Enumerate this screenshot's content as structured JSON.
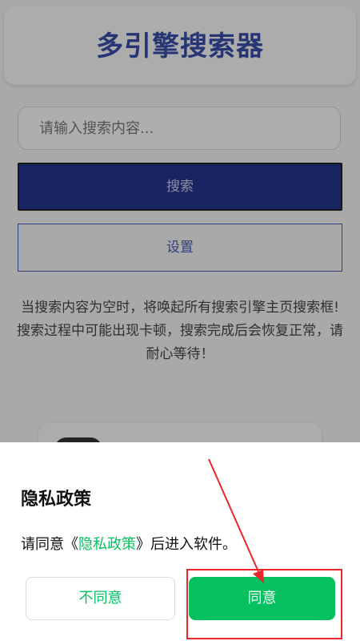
{
  "app": {
    "title": "多引擎搜索器",
    "search": {
      "placeholder": "请输入搜索内容..."
    },
    "search_label": "搜索",
    "settings_label": "设置",
    "notice_line1": "当搜索内容为空时，将唤起所有搜索引擎主页搜索框!",
    "notice_line2": "搜索过程中可能出现卡顿，搜索完成后会恢复正常，请耐心等待！"
  },
  "privacy_dialog": {
    "title": "隐私政策",
    "message_prefix": "请同意《",
    "policy_link": "隐私政策",
    "message_suffix": "》后进入软件。",
    "decline_label": "不同意",
    "agree_label": "同意"
  },
  "colors": {
    "brand_blue": "#26348f",
    "accent_green": "#07c160",
    "annotation_red": "#e8262b"
  }
}
